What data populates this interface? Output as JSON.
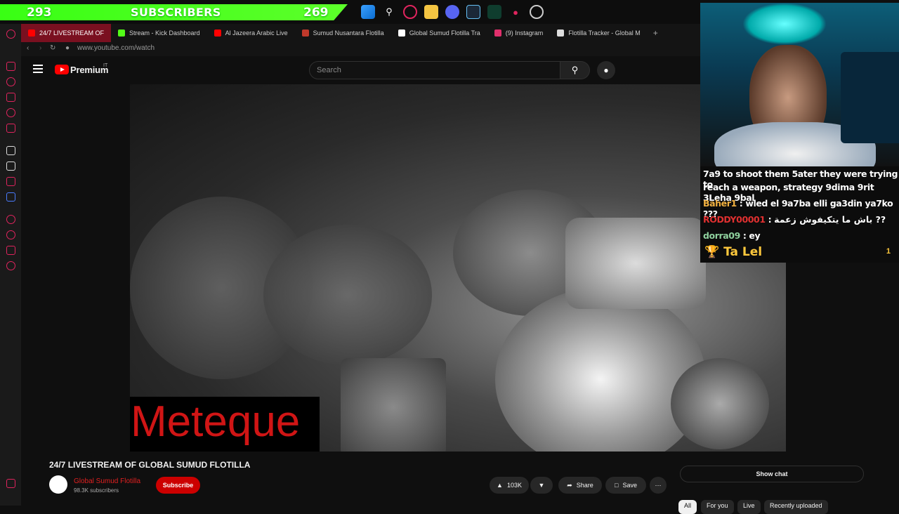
{
  "overlay": {
    "subscribers_left": "293",
    "subscribers_title": "SUBSCRIBERS",
    "subscribers_right": "269"
  },
  "taskbar_icons": [
    "windows-icon",
    "search-icon",
    "opera-icon",
    "folder-icon",
    "discord-icon",
    "steam-icon",
    "app-icon",
    "maps-icon",
    "chrome-icon"
  ],
  "tabs": [
    {
      "label": "24/7 LIVESTREAM OF",
      "fav": "#ff0000",
      "active": true
    },
    {
      "label": "Stream - Kick Dashboard",
      "fav": "#53fc18",
      "active": false
    },
    {
      "label": "Al Jazeera Arabic Live",
      "fav": "#ff0000",
      "active": false
    },
    {
      "label": "Sumud Nusantara Flotilla",
      "fav": "#c0392b",
      "active": false
    },
    {
      "label": "Global Sumud Flotilla Tra",
      "fav": "#ffffff",
      "active": false
    },
    {
      "label": "(9) Instagram",
      "fav": "#e1306c",
      "active": false
    },
    {
      "label": "Flotilla Tracker - Global M",
      "fav": "#dddddd",
      "active": false
    }
  ],
  "address": {
    "url": "www.youtube.com/watch"
  },
  "youtube": {
    "brand": "Premium",
    "country": "IT",
    "search_placeholder": "Search"
  },
  "video": {
    "overlay_text": "Meteque",
    "title": "24/7 LIVESTREAM OF GLOBAL SUMUD FLOTILLA",
    "channel": "Global Sumud Flotilla",
    "subscribers": "98.3K subscribers",
    "subscribe_label": "Subscribe",
    "likes": "103K",
    "share_label": "Share",
    "save_label": "Save",
    "show_chat_label": "Show chat"
  },
  "chips": [
    "All",
    "For you",
    "Live",
    "Recently uploaded"
  ],
  "chat": {
    "lines": [
      {
        "user": "",
        "text": "7a9 to shoot them 5ater they were trying to",
        "color": "#ffffff"
      },
      {
        "user": "",
        "text": "reach a weapon, strategy 9dima 9rit 3Leha 9bal",
        "color": "#ffffff"
      },
      {
        "user": "Baher1",
        "text": ": wled el 9a7ba elli ga3din ya7ko ???",
        "color": "#f0b040"
      },
      {
        "user": "RODDY00001",
        "text": ": باش ما يتكيفوش زعمة ??",
        "color": "#e03030"
      },
      {
        "user": "dorra09",
        "text": ": ey",
        "color": "#8fd19e"
      }
    ],
    "highlight": "Ta Lel",
    "highlight_count": "1"
  },
  "colors": {
    "accent": "#39ff14",
    "youtube_red": "#ff0000",
    "tab_active": "#7a1020"
  }
}
